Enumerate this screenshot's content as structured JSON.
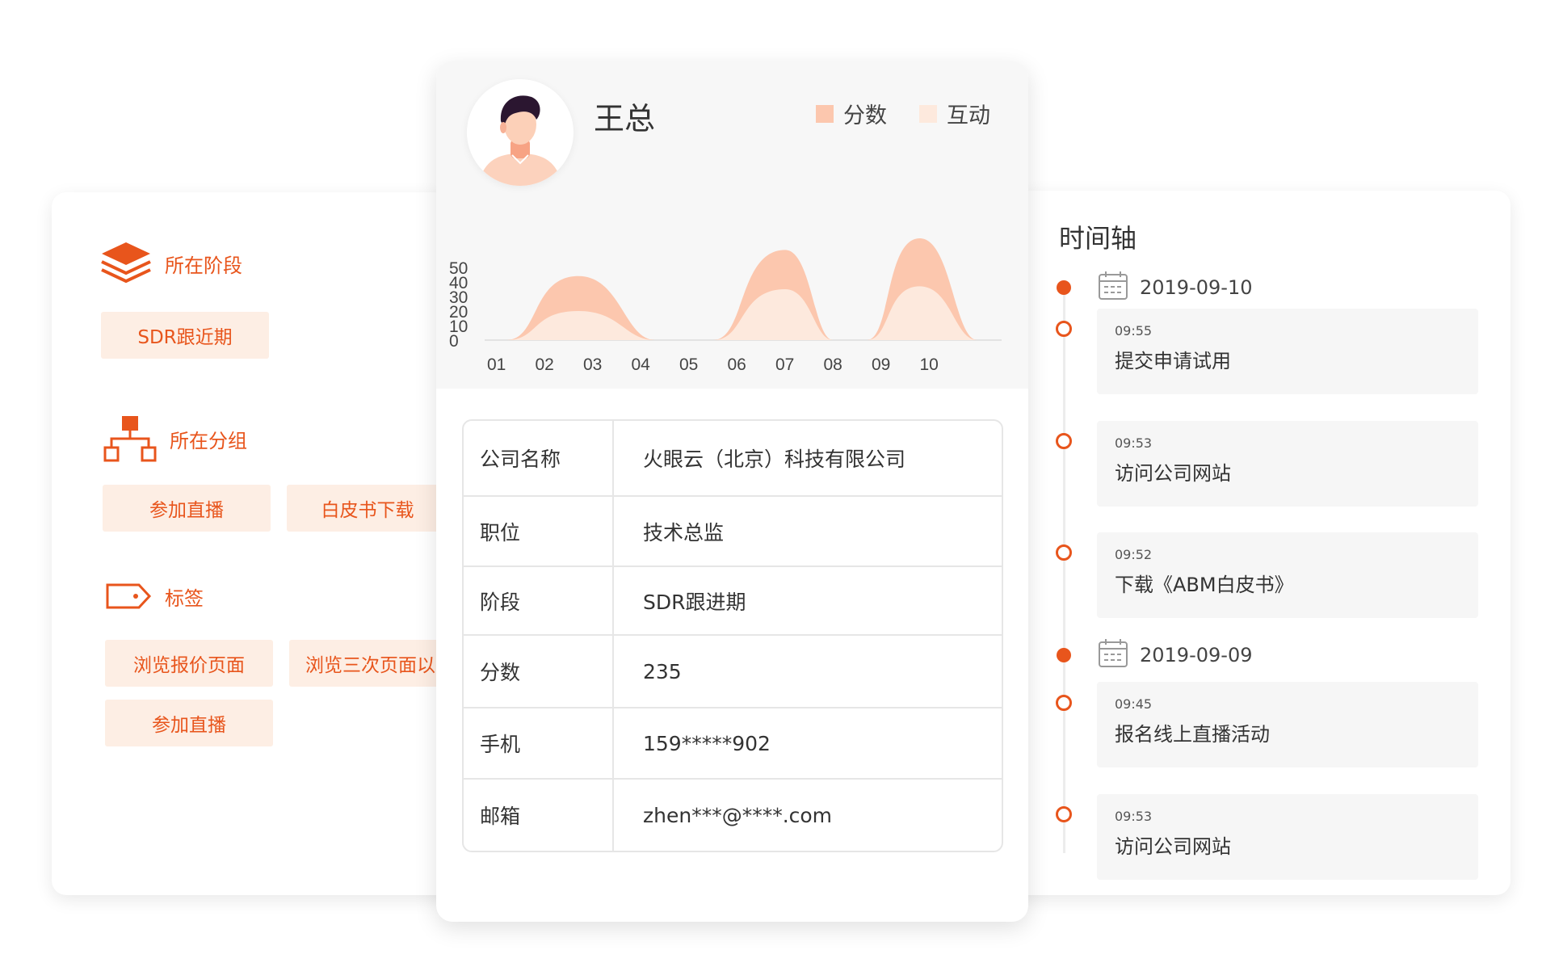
{
  "left_panel": {
    "stage": {
      "title": "所在阶段",
      "tags": [
        "SDR跟近期"
      ]
    },
    "group": {
      "title": "所在分组",
      "tags": [
        "参加直播",
        "白皮书下载"
      ]
    },
    "labels": {
      "title": "标签",
      "tags": [
        "浏览报价页面",
        "浏览三次页面以",
        "参加直播"
      ]
    }
  },
  "profile": {
    "name": "王总",
    "legend": [
      {
        "label": "分数",
        "color": "#fcc7ae"
      },
      {
        "label": "互动",
        "color": "#fde9dd"
      }
    ]
  },
  "chart_data": {
    "type": "area",
    "x": [
      "01",
      "02",
      "03",
      "04",
      "05",
      "06",
      "07",
      "08",
      "09",
      "10"
    ],
    "y_ticks": [
      "50",
      "40",
      "30",
      "20",
      "10",
      "0"
    ],
    "ylim": [
      0,
      50
    ],
    "series": [
      {
        "name": "分数",
        "peaks": [
          {
            "x": 1.7,
            "y": 44
          },
          {
            "x": 6.0,
            "y": 62
          },
          {
            "x": 8.8,
            "y": 70
          }
        ]
      },
      {
        "name": "互动",
        "peaks": [
          {
            "x": 1.7,
            "y": 20
          },
          {
            "x": 6.0,
            "y": 35
          },
          {
            "x": 8.8,
            "y": 37
          }
        ]
      }
    ]
  },
  "info": [
    {
      "label": "公司名称",
      "value": "火眼云（北京）科技有限公司"
    },
    {
      "label": "职位",
      "value": "技术总监"
    },
    {
      "label": "阶段",
      "value": "SDR跟进期"
    },
    {
      "label": "分数",
      "value": "235"
    },
    {
      "label": "手机",
      "value": "159*****902"
    },
    {
      "label": "邮箱",
      "value": "zhen***@****.com"
    }
  ],
  "timeline": {
    "title": "时间轴",
    "dates": [
      "2019-09-10",
      "2019-09-09"
    ],
    "events": [
      {
        "time": "09:55",
        "text": "提交申请试用"
      },
      {
        "time": "09:53",
        "text": "访问公司网站"
      },
      {
        "time": "09:52",
        "text": "下载《ABM白皮书》"
      },
      {
        "time": "09:45",
        "text": "报名线上直播活动"
      },
      {
        "time": "09:53",
        "text": "访问公司网站"
      }
    ]
  },
  "colors": {
    "accent": "#e8551c",
    "tag_bg": "#fdeee4",
    "score": "#fcc7ae",
    "interaction": "#fde9dd"
  }
}
